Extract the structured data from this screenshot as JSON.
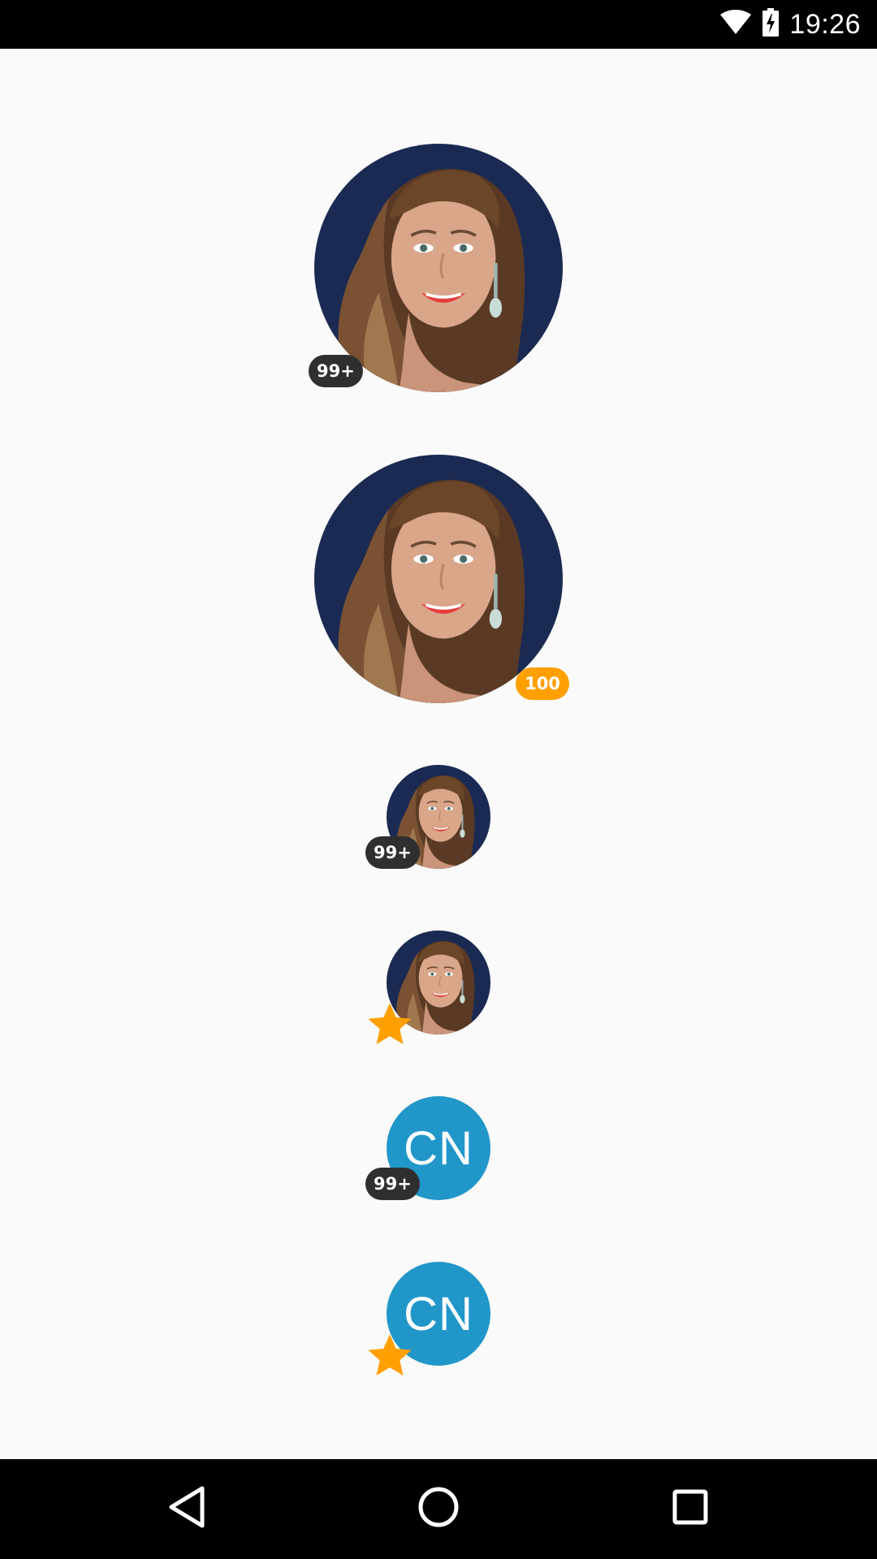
{
  "status_bar": {
    "time": "19:26",
    "icons": [
      "wifi-icon",
      "battery-charging-icon"
    ]
  },
  "avatars": [
    {
      "kind": "photo",
      "size": "large",
      "badge": {
        "type": "count",
        "text": "99+",
        "position": "bottom-left",
        "color": "#2f2f2f"
      }
    },
    {
      "kind": "photo",
      "size": "large",
      "badge": {
        "type": "count",
        "text": "100",
        "position": "bottom-right",
        "color": "#ffa000"
      }
    },
    {
      "kind": "photo",
      "size": "small",
      "badge": {
        "type": "count",
        "text": "99+",
        "position": "bottom-left",
        "color": "#2f2f2f"
      }
    },
    {
      "kind": "photo",
      "size": "small",
      "badge": {
        "type": "star",
        "icon": "star-icon",
        "position": "bottom-left",
        "color": "#ffa000"
      }
    },
    {
      "kind": "initials",
      "size": "small",
      "initials": "CN",
      "background": "#2196c9",
      "badge": {
        "type": "count",
        "text": "99+",
        "position": "bottom-left",
        "color": "#2f2f2f"
      }
    },
    {
      "kind": "initials",
      "size": "small",
      "initials": "CN",
      "background": "#2196c9",
      "badge": {
        "type": "star",
        "icon": "star-icon",
        "position": "bottom-left",
        "color": "#ffa000"
      }
    }
  ],
  "nav_bar": {
    "buttons": [
      "back-icon",
      "home-icon",
      "recents-icon"
    ]
  }
}
